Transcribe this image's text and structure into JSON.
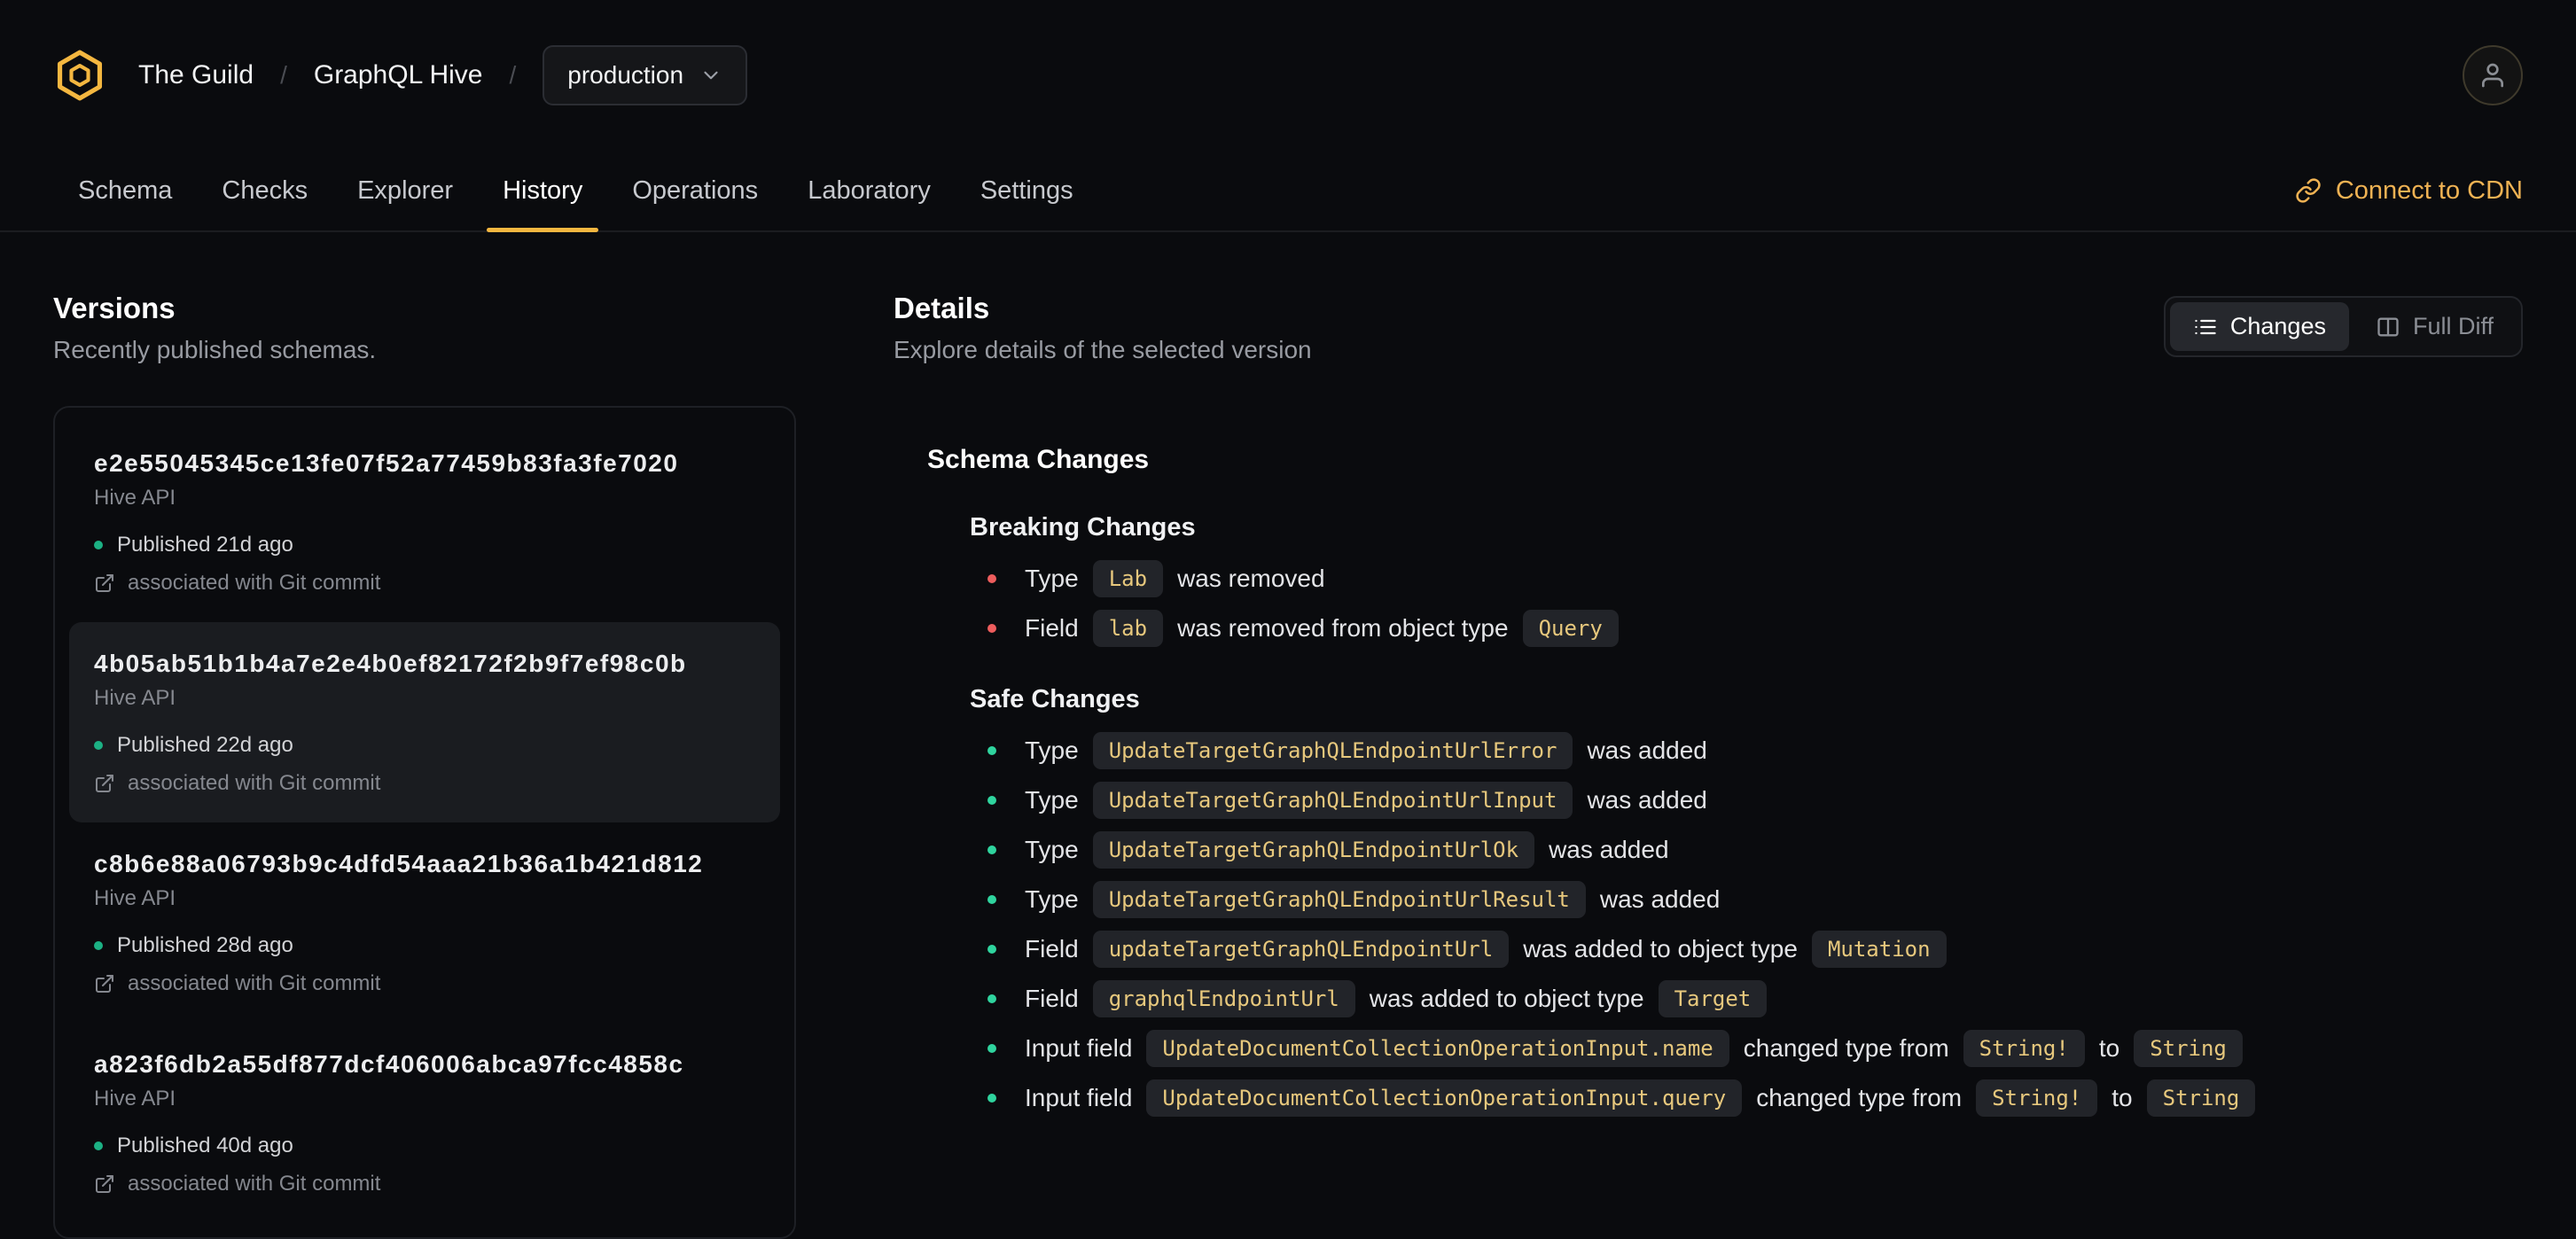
{
  "header": {
    "org": "The Guild",
    "project": "GraphQL Hive",
    "separator": "/",
    "target": "production",
    "tabs": [
      {
        "label": "Schema"
      },
      {
        "label": "Checks"
      },
      {
        "label": "Explorer"
      },
      {
        "label": "History"
      },
      {
        "label": "Operations"
      },
      {
        "label": "Laboratory"
      },
      {
        "label": "Settings"
      }
    ],
    "active_tab": "History",
    "connect_cdn": "Connect to CDN"
  },
  "versions": {
    "title": "Versions",
    "subtitle": "Recently published schemas.",
    "items": [
      {
        "hash": "e2e55045345ce13fe07f52a77459b83fa3fe7020",
        "service": "Hive API",
        "published": "Published 21d ago",
        "commit": "associated with Git commit",
        "selected": false
      },
      {
        "hash": "4b05ab51b1b4a7e2e4b0ef82172f2b9f7ef98c0b",
        "service": "Hive API",
        "published": "Published 22d ago",
        "commit": "associated with Git commit",
        "selected": true
      },
      {
        "hash": "c8b6e88a06793b9c4dfd54aaa21b36a1b421d812",
        "service": "Hive API",
        "published": "Published 28d ago",
        "commit": "associated with Git commit",
        "selected": false
      },
      {
        "hash": "a823f6db2a55df877dcf406006abca97fcc4858c",
        "service": "Hive API",
        "published": "Published 40d ago",
        "commit": "associated with Git commit",
        "selected": false
      }
    ]
  },
  "details": {
    "title": "Details",
    "subtitle": "Explore details of the selected version",
    "toggle": {
      "changes": "Changes",
      "full_diff": "Full Diff"
    },
    "schema_changes_title": "Schema Changes",
    "breaking": {
      "title": "Breaking Changes",
      "items": [
        {
          "parts": [
            {
              "t": "text",
              "v": "Type"
            },
            {
              "t": "code",
              "v": "Lab"
            },
            {
              "t": "text",
              "v": "was removed"
            }
          ]
        },
        {
          "parts": [
            {
              "t": "text",
              "v": "Field"
            },
            {
              "t": "code",
              "v": "lab"
            },
            {
              "t": "text",
              "v": "was removed from object type"
            },
            {
              "t": "code",
              "v": "Query"
            }
          ]
        }
      ]
    },
    "safe": {
      "title": "Safe Changes",
      "items": [
        {
          "parts": [
            {
              "t": "text",
              "v": "Type"
            },
            {
              "t": "code",
              "v": "UpdateTargetGraphQLEndpointUrlError"
            },
            {
              "t": "text",
              "v": "was added"
            }
          ]
        },
        {
          "parts": [
            {
              "t": "text",
              "v": "Type"
            },
            {
              "t": "code",
              "v": "UpdateTargetGraphQLEndpointUrlInput"
            },
            {
              "t": "text",
              "v": "was added"
            }
          ]
        },
        {
          "parts": [
            {
              "t": "text",
              "v": "Type"
            },
            {
              "t": "code",
              "v": "UpdateTargetGraphQLEndpointUrlOk"
            },
            {
              "t": "text",
              "v": "was added"
            }
          ]
        },
        {
          "parts": [
            {
              "t": "text",
              "v": "Type"
            },
            {
              "t": "code",
              "v": "UpdateTargetGraphQLEndpointUrlResult"
            },
            {
              "t": "text",
              "v": "was added"
            }
          ]
        },
        {
          "parts": [
            {
              "t": "text",
              "v": "Field"
            },
            {
              "t": "code",
              "v": "updateTargetGraphQLEndpointUrl"
            },
            {
              "t": "text",
              "v": "was added to object type"
            },
            {
              "t": "code",
              "v": "Mutation"
            }
          ]
        },
        {
          "parts": [
            {
              "t": "text",
              "v": "Field"
            },
            {
              "t": "code",
              "v": "graphqlEndpointUrl"
            },
            {
              "t": "text",
              "v": "was added to object type"
            },
            {
              "t": "code",
              "v": "Target"
            }
          ]
        },
        {
          "parts": [
            {
              "t": "text",
              "v": "Input field"
            },
            {
              "t": "code",
              "v": "UpdateDocumentCollectionOperationInput.name"
            },
            {
              "t": "text",
              "v": "changed type from"
            },
            {
              "t": "code",
              "v": "String!"
            },
            {
              "t": "text",
              "v": "to"
            },
            {
              "t": "code",
              "v": "String"
            }
          ]
        },
        {
          "parts": [
            {
              "t": "text",
              "v": "Input field"
            },
            {
              "t": "code",
              "v": "UpdateDocumentCollectionOperationInput.query"
            },
            {
              "t": "text",
              "v": "changed type from"
            },
            {
              "t": "code",
              "v": "String!"
            },
            {
              "t": "text",
              "v": "to"
            },
            {
              "t": "code",
              "v": "String"
            }
          ]
        }
      ]
    }
  },
  "colors": {
    "accent": "#f4b740",
    "breaking_bullet": "#ee5d5d",
    "safe_bullet": "#2fd49e",
    "published_dot": "#1cb184",
    "code_text": "#e7c87d"
  }
}
